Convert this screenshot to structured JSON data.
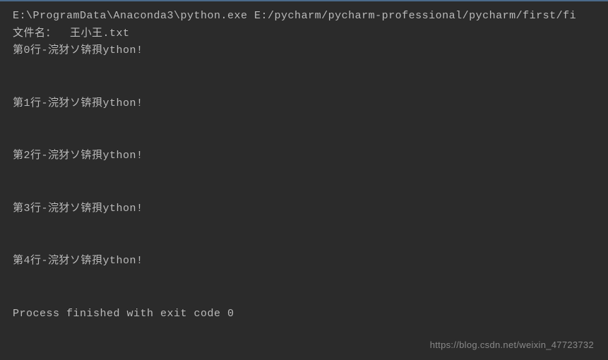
{
  "console": {
    "command_line": "E:\\ProgramData\\Anaconda3\\python.exe E:/pycharm/pycharm-professional/pycharm/first/fi",
    "filename_line": "文件名：  王小王.txt",
    "output_lines": [
      "第0行-浣犲ソ锛孭ython!",
      "第1行-浣犲ソ锛孭ython!",
      "第2行-浣犲ソ锛孭ython!",
      "第3行-浣犲ソ锛孭ython!",
      "第4行-浣犲ソ锛孭ython!"
    ],
    "exit_message": "Process finished with exit code 0"
  },
  "watermark": "https://blog.csdn.net/weixin_47723732"
}
